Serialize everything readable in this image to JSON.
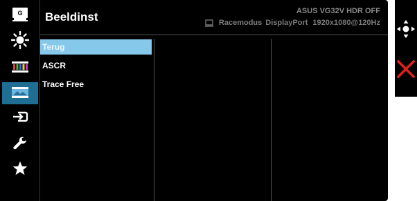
{
  "header": {
    "title": "Beeldinst",
    "model": "ASUS VG32V HDR OFF",
    "mode": "Racemodus",
    "input": "DisplayPort",
    "resolution": "1920x1080@120Hz"
  },
  "sidebar": {
    "items": [
      {
        "icon": "gameplus-icon",
        "label": "G"
      },
      {
        "icon": "brightness-icon"
      },
      {
        "icon": "color-icon"
      },
      {
        "icon": "image-icon"
      },
      {
        "icon": "input-select-icon"
      },
      {
        "icon": "wrench-icon"
      },
      {
        "icon": "star-icon"
      }
    ]
  },
  "menu": {
    "items": [
      "Terug",
      "ASCR",
      "Trace Free"
    ]
  },
  "nav": {
    "items": [
      {
        "icon": "joystick-icon"
      },
      {
        "icon": "close-icon"
      }
    ]
  },
  "colors": {
    "accent": "#1f6f95",
    "selection": "#86c8ea",
    "close": "#e02020"
  }
}
